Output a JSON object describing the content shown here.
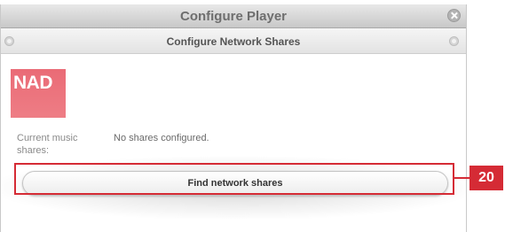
{
  "window": {
    "title": "Configure Player",
    "close_icon": "close-circle-icon"
  },
  "panel": {
    "title": "Configure Network Shares",
    "left_icon": "back-circle-icon",
    "right_icon": "options-circle-icon"
  },
  "logo": {
    "text": "NAD",
    "color": "#ec717b"
  },
  "shares": {
    "label": "Current music shares:",
    "value": "No shares configured."
  },
  "actions": {
    "find_label": "Find network shares"
  },
  "callout": {
    "number": "20",
    "color": "#d52b35"
  }
}
